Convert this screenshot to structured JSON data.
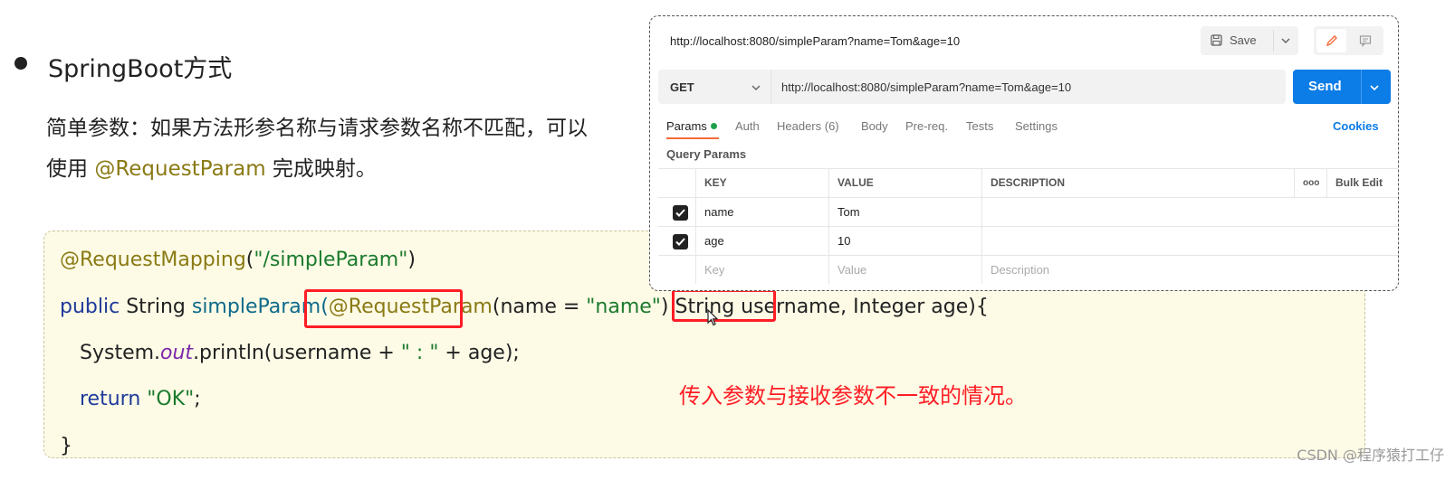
{
  "slide": {
    "bullet_title": "SpringBoot方式",
    "desc_line1": "简单参数：如果方法形参名称与请求参数名称不匹配，可以",
    "desc_line2_pre": "使用 ",
    "desc_line2_anno": "@RequestParam",
    "desc_line2_post": " 完成映射。"
  },
  "code": {
    "line1_anno": "@RequestMapping",
    "line1_paren_open": "(",
    "line1_str": "\"/simpleParam\"",
    "line1_paren_close": ")",
    "line2_kw": "public",
    "line2_type": " String ",
    "line2_fn": "simpleParam(",
    "line2_anno": "@RequestParam",
    "line2_mid1": "(name = ",
    "line2_str": "\"name\"",
    "line2_mid2": ") String ",
    "line2_param": "username",
    "line2_tail": ", Integer age){",
    "line3_pre": "System.",
    "line3_field": "out",
    "line3_mid": ".println(username + ",
    "line3_str": "\" : \"",
    "line3_tail": " + age);",
    "line4_kw": "return",
    "line4_sp": " ",
    "line4_str": "\"OK\"",
    "line4_tail": ";",
    "line5": "}"
  },
  "note": "传入参数与接收参数不一致的情况。",
  "postman": {
    "title_url": "http://localhost:8080/simpleParam?name=Tom&age=10",
    "save_label": "Save",
    "method": "GET",
    "request_url": "http://localhost:8080/simpleParam?name=Tom&age=10",
    "send_label": "Send",
    "tabs": [
      "Params",
      "Auth",
      "Headers (6)",
      "Body",
      "Pre-req.",
      "Tests",
      "Settings"
    ],
    "cookies_label": "Cookies",
    "query_params_title": "Query Params",
    "columns": {
      "key": "KEY",
      "value": "VALUE",
      "description": "DESCRIPTION",
      "more": "ooo",
      "bulk_edit": "Bulk Edit"
    },
    "rows": [
      {
        "key": "name",
        "value": "Tom",
        "checked": true
      },
      {
        "key": "age",
        "value": "10",
        "checked": true
      }
    ],
    "placeholders": {
      "key": "Key",
      "value": "Value",
      "description": "Description"
    },
    "colors": {
      "send": "#0c7ce6",
      "tab_underline": "#f26b3a",
      "params_dot": "#1aa14a"
    }
  },
  "watermark": "CSDN @程序猿打工仔",
  "colors": {
    "highlight": "#ff1d25",
    "annotation": "#8a7a14",
    "string": "#1b7a2d",
    "keyword": "#1f3a9a"
  }
}
